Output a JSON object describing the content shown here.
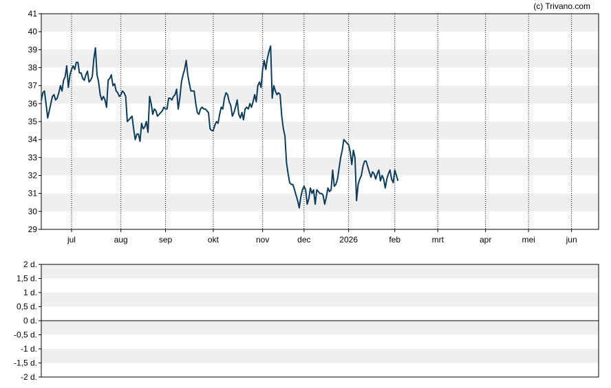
{
  "credit": "(c) Trivano.com",
  "colors": {
    "line": "#0d3b5a",
    "band": "#efefef",
    "axis": "#000000"
  },
  "chart_data": [
    {
      "type": "line",
      "ylim": [
        29,
        41
      ],
      "yticks": [
        "29",
        "30",
        "31",
        "32",
        "33",
        "34",
        "35",
        "36",
        "37",
        "38",
        "39",
        "40",
        "41"
      ],
      "x_range_days": [
        0,
        350
      ],
      "xticks": [
        {
          "label": "jul",
          "day": 19
        },
        {
          "label": "aug",
          "day": 50
        },
        {
          "label": "sep",
          "day": 78
        },
        {
          "label": "okt",
          "day": 108
        },
        {
          "label": "nov",
          "day": 139
        },
        {
          "label": "dec",
          "day": 165
        },
        {
          "label": "2026",
          "day": 193
        },
        {
          "label": "feb",
          "day": 222
        },
        {
          "label": "mrt",
          "day": 249
        },
        {
          "label": "apr",
          "day": 279
        },
        {
          "label": "mei",
          "day": 306
        },
        {
          "label": "jun",
          "day": 333
        }
      ],
      "grid": "horizontal bands, vertical dotted lines at month ticks",
      "series": [
        {
          "values": [
            [
              0,
              36.2
            ],
            [
              1,
              36.6
            ],
            [
              2,
              36.7
            ],
            [
              3,
              36.0
            ],
            [
              4,
              35.2
            ],
            [
              5,
              35.6
            ],
            [
              6,
              36.0
            ],
            [
              7,
              36.4
            ],
            [
              8,
              36.5
            ],
            [
              9,
              36.2
            ],
            [
              10,
              36.3
            ],
            [
              11,
              36.6
            ],
            [
              12,
              37.0
            ],
            [
              13,
              36.7
            ],
            [
              14,
              37.3
            ],
            [
              15,
              37.5
            ],
            [
              16,
              38.1
            ],
            [
              17,
              36.9
            ],
            [
              18,
              37.6
            ],
            [
              19,
              37.9
            ],
            [
              20,
              38.1
            ],
            [
              21,
              37.9
            ],
            [
              22,
              38.3
            ],
            [
              23,
              38.3
            ],
            [
              24,
              37.7
            ],
            [
              25,
              37.7
            ],
            [
              26,
              37.4
            ],
            [
              27,
              37.3
            ],
            [
              28,
              37.6
            ],
            [
              29,
              37.8
            ],
            [
              30,
              37.2
            ],
            [
              31,
              37.3
            ],
            [
              32,
              37.5
            ],
            [
              33,
              38.5
            ],
            [
              34,
              39.1
            ],
            [
              35,
              37.6
            ],
            [
              36,
              37.2
            ],
            [
              37,
              36.5
            ],
            [
              38,
              36.2
            ],
            [
              39,
              36.4
            ],
            [
              40,
              36.2
            ],
            [
              41,
              35.8
            ],
            [
              42,
              37.3
            ],
            [
              43,
              37.4
            ],
            [
              44,
              37.6
            ],
            [
              45,
              37.0
            ],
            [
              46,
              37.1
            ],
            [
              47,
              36.7
            ],
            [
              48,
              36.6
            ],
            [
              49,
              36.4
            ],
            [
              50,
              36.5
            ],
            [
              51,
              36.7
            ],
            [
              52,
              36.6
            ],
            [
              53,
              36.4
            ],
            [
              54,
              35.0
            ],
            [
              55,
              35.1
            ],
            [
              56,
              35.2
            ],
            [
              57,
              35.3
            ],
            [
              58,
              34.6
            ],
            [
              59,
              34.0
            ],
            [
              60,
              34.3
            ],
            [
              61,
              34.3
            ],
            [
              62,
              33.9
            ],
            [
              63,
              34.9
            ],
            [
              64,
              34.6
            ],
            [
              65,
              34.7
            ],
            [
              66,
              35.0
            ],
            [
              67,
              34.4
            ],
            [
              68,
              36.4
            ],
            [
              69,
              36.0
            ],
            [
              70,
              35.4
            ],
            [
              71,
              35.7
            ],
            [
              72,
              35.6
            ],
            [
              73,
              35.3
            ],
            [
              74,
              35.4
            ],
            [
              75,
              35.5
            ],
            [
              76,
              35.6
            ],
            [
              77,
              35.8
            ],
            [
              78,
              35.7
            ],
            [
              79,
              35.7
            ],
            [
              80,
              36.3
            ],
            [
              81,
              36.3
            ],
            [
              82,
              36.2
            ],
            [
              83,
              36.4
            ],
            [
              84,
              36.5
            ],
            [
              85,
              36.8
            ],
            [
              86,
              35.7
            ],
            [
              87,
              36.3
            ],
            [
              88,
              37.2
            ],
            [
              89,
              37.6
            ],
            [
              90,
              37.9
            ],
            [
              91,
              38.4
            ],
            [
              92,
              37.6
            ],
            [
              93,
              37.1
            ],
            [
              94,
              36.7
            ],
            [
              95,
              36.7
            ],
            [
              96,
              36.7
            ],
            [
              97,
              36.0
            ],
            [
              98,
              35.5
            ],
            [
              99,
              35.4
            ],
            [
              100,
              35.7
            ],
            [
              101,
              35.8
            ],
            [
              102,
              35.7
            ],
            [
              103,
              35.7
            ],
            [
              104,
              35.6
            ],
            [
              105,
              35.5
            ],
            [
              106,
              34.6
            ],
            [
              107,
              34.5
            ],
            [
              108,
              34.5
            ],
            [
              109,
              34.8
            ],
            [
              110,
              35.0
            ],
            [
              111,
              34.9
            ],
            [
              112,
              35.4
            ],
            [
              113,
              35.8
            ],
            [
              114,
              35.7
            ],
            [
              115,
              36.3
            ],
            [
              116,
              36.6
            ],
            [
              117,
              36.5
            ],
            [
              118,
              36.1
            ],
            [
              119,
              35.9
            ],
            [
              120,
              35.3
            ],
            [
              121,
              35.5
            ],
            [
              122,
              35.8
            ],
            [
              123,
              36.2
            ],
            [
              124,
              35.4
            ],
            [
              125,
              35.2
            ],
            [
              126,
              35.5
            ],
            [
              127,
              35.1
            ],
            [
              128,
              35.7
            ],
            [
              129,
              35.8
            ],
            [
              130,
              35.7
            ],
            [
              131,
              36.0
            ],
            [
              132,
              35.8
            ],
            [
              133,
              36.1
            ],
            [
              134,
              36.5
            ],
            [
              135,
              36.1
            ],
            [
              136,
              37.0
            ],
            [
              137,
              37.2
            ],
            [
              138,
              36.9
            ],
            [
              139,
              37.9
            ],
            [
              140,
              38.4
            ],
            [
              141,
              37.9
            ],
            [
              142,
              38.5
            ],
            [
              143,
              38.9
            ],
            [
              144,
              39.2
            ],
            [
              145,
              36.3
            ],
            [
              146,
              37.0
            ],
            [
              147,
              36.7
            ],
            [
              148,
              36.5
            ],
            [
              149,
              36.6
            ],
            [
              150,
              36.5
            ],
            [
              151,
              35.3
            ],
            [
              152,
              34.6
            ],
            [
              153,
              34.2
            ],
            [
              154,
              32.7
            ],
            [
              155,
              32.1
            ],
            [
              156,
              31.6
            ],
            [
              157,
              31.5
            ],
            [
              158,
              31.5
            ],
            [
              159,
              31.2
            ],
            [
              160,
              30.9
            ],
            [
              161,
              30.6
            ],
            [
              162,
              30.2
            ],
            [
              163,
              30.8
            ],
            [
              164,
              31.2
            ],
            [
              165,
              31.4
            ],
            [
              166,
              31.2
            ],
            [
              167,
              30.4
            ],
            [
              168,
              30.7
            ],
            [
              169,
              31.3
            ],
            [
              170,
              31.0
            ],
            [
              171,
              31.2
            ],
            [
              172,
              30.4
            ],
            [
              173,
              31.2
            ],
            [
              174,
              31.1
            ],
            [
              175,
              31.0
            ],
            [
              176,
              31.0
            ],
            [
              177,
              30.9
            ],
            [
              178,
              30.4
            ],
            [
              179,
              30.8
            ],
            [
              180,
              31.3
            ],
            [
              181,
              31.1
            ],
            [
              182,
              31.2
            ],
            [
              183,
              32.3
            ],
            [
              184,
              31.4
            ],
            [
              185,
              31.5
            ],
            [
              186,
              31.8
            ],
            [
              187,
              32.4
            ],
            [
              188,
              33.0
            ],
            [
              189,
              33.4
            ],
            [
              190,
              34.0
            ],
            [
              191,
              33.9
            ],
            [
              192,
              33.8
            ],
            [
              193,
              33.7
            ],
            [
              194,
              33.3
            ],
            [
              195,
              32.6
            ],
            [
              196,
              33.4
            ],
            [
              197,
              33.0
            ],
            [
              198,
              30.6
            ],
            [
              199,
              31.5
            ],
            [
              200,
              31.8
            ],
            [
              201,
              32.0
            ],
            [
              202,
              32.5
            ],
            [
              203,
              32.8
            ],
            [
              204,
              32.8
            ],
            [
              205,
              32.5
            ],
            [
              206,
              32.2
            ],
            [
              207,
              31.9
            ],
            [
              208,
              32.2
            ],
            [
              209,
              32.1
            ],
            [
              210,
              31.8
            ],
            [
              211,
              32.1
            ],
            [
              212,
              32.3
            ],
            [
              213,
              31.7
            ],
            [
              214,
              32.0
            ],
            [
              215,
              31.8
            ],
            [
              216,
              31.3
            ],
            [
              217,
              31.8
            ],
            [
              218,
              32.1
            ],
            [
              219,
              32.3
            ],
            [
              220,
              31.8
            ],
            [
              221,
              31.6
            ],
            [
              222,
              32.3
            ],
            [
              223,
              32.0
            ],
            [
              224,
              31.7
            ]
          ]
        }
      ]
    },
    {
      "type": "line",
      "ylim": [
        -2,
        2
      ],
      "yticks": [
        "-2 d.",
        "-1,5 d.",
        "-1 d.",
        "-0,5 d.",
        "0 d.",
        "0,5 d.",
        "1 d.",
        "1,5 d.",
        "2 d."
      ],
      "grid": "horizontal bands",
      "zero_line": true
    }
  ]
}
